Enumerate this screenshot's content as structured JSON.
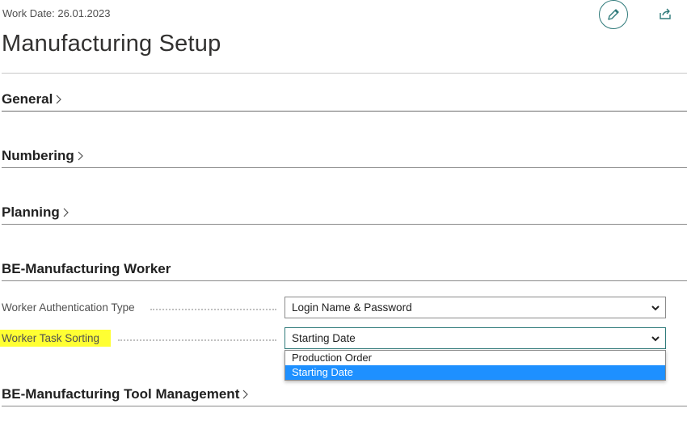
{
  "header": {
    "work_date": "Work Date: 26.01.2023",
    "title": "Manufacturing Setup",
    "edit_icon": "pencil-icon",
    "share_icon": "share-icon"
  },
  "sections": {
    "general": "General",
    "numbering": "Numbering",
    "planning": "Planning",
    "worker": "BE-Manufacturing Worker",
    "tool": "BE-Manufacturing Tool Management"
  },
  "fields": {
    "auth_type": {
      "label": "Worker Authentication Type",
      "value": "Login Name & Password"
    },
    "task_sorting": {
      "label": "Worker Task Sorting",
      "value": "Starting Date",
      "options": [
        "Production Order",
        "Starting Date"
      ],
      "selected": "Starting Date"
    }
  },
  "colors": {
    "accent": "#2f7a7a",
    "highlight": "#ffff33",
    "selected_option": "#1e90ff"
  }
}
